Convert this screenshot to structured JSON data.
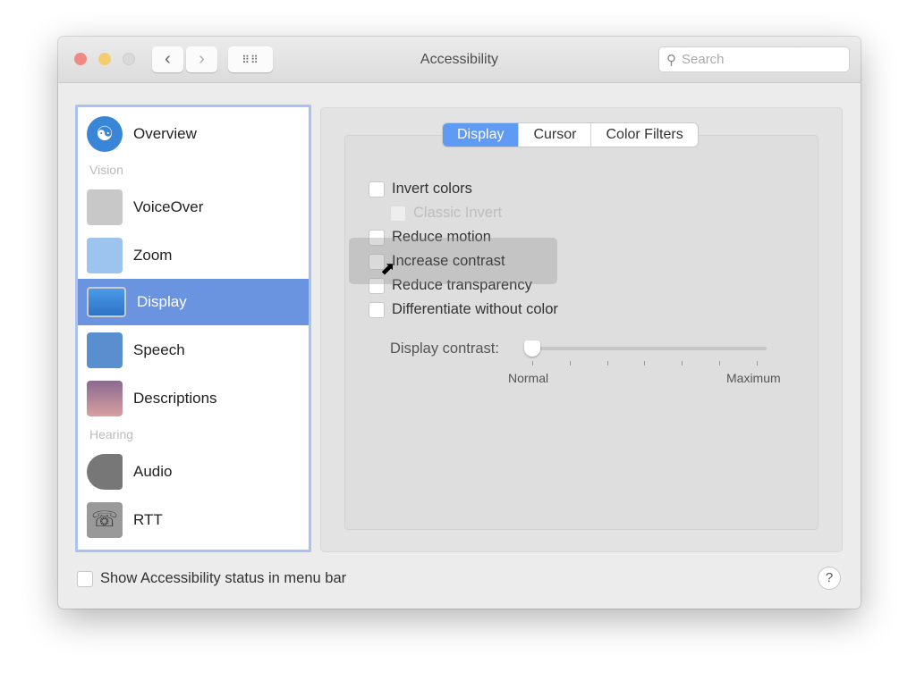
{
  "window": {
    "title": "Accessibility",
    "search_placeholder": "Search"
  },
  "sidebar": {
    "items": [
      {
        "label": "Overview",
        "icon": "accessibility-icon"
      },
      {
        "section": "Vision"
      },
      {
        "label": "VoiceOver",
        "icon": "voiceover-icon"
      },
      {
        "label": "Zoom",
        "icon": "zoom-icon"
      },
      {
        "label": "Display",
        "icon": "display-icon",
        "selected": true
      },
      {
        "label": "Speech",
        "icon": "speech-icon"
      },
      {
        "label": "Descriptions",
        "icon": "descriptions-icon"
      },
      {
        "section": "Hearing"
      },
      {
        "label": "Audio",
        "icon": "speaker-icon"
      },
      {
        "label": "RTT",
        "icon": "telephone-icon"
      }
    ]
  },
  "tabs": [
    {
      "label": "Display",
      "selected": true
    },
    {
      "label": "Cursor"
    },
    {
      "label": "Color Filters"
    }
  ],
  "options": [
    {
      "label": "Invert colors",
      "checked": false
    },
    {
      "label": "Classic Invert",
      "checked": false,
      "disabled": true
    },
    {
      "label": "Reduce motion",
      "checked": false
    },
    {
      "label": "Increase contrast",
      "checked": false
    },
    {
      "label": "Reduce transparency",
      "checked": false
    },
    {
      "label": "Differentiate without color",
      "checked": false
    }
  ],
  "contrast": {
    "label": "Display contrast:",
    "min_label": "Normal",
    "max_label": "Maximum",
    "value": 0
  },
  "footer": {
    "status_label": "Show Accessibility status in menu bar",
    "help": "?"
  },
  "colors": {
    "accent": "#5f9af5",
    "selection": "#6a94e0"
  }
}
